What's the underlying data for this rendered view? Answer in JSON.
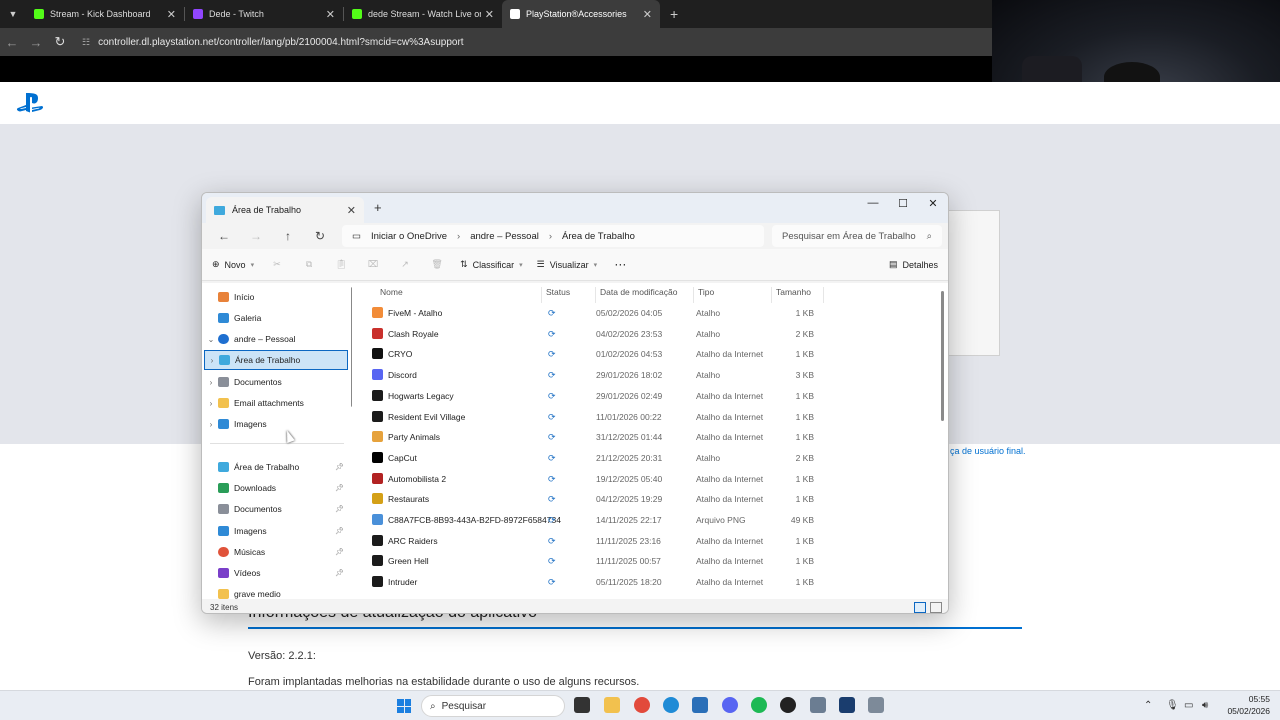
{
  "browser": {
    "tabs": [
      {
        "title": "Stream - Kick Dashboard",
        "favicon_color": "#53fc18"
      },
      {
        "title": "Dede - Twitch",
        "favicon_color": "#9146ff"
      },
      {
        "title": "dede Stream - Watch Live on K",
        "favicon_color": "#53fc18"
      },
      {
        "title": "PlayStation®Accessories",
        "favicon_color": "#ffffff"
      }
    ],
    "url": "controller.dl.playstation.net/controller/lang/pb/2100004.html?smcid=cw%3Asupport"
  },
  "page": {
    "link_text": "ça de usuário final.",
    "section_title": "Informações de atualização do aplicativo",
    "version": "Versão: 2.2.1:",
    "description": "Foram implantadas melhorias na estabilidade durante o uso de alguns recursos."
  },
  "explorer": {
    "tab_title": "Área de Trabalho",
    "breadcrumb": [
      "Iniciar o OneDrive",
      "andre – Pessoal",
      "Área de Trabalho"
    ],
    "search_placeholder": "Pesquisar em Área de Trabalho",
    "toolbar": {
      "new": "Novo",
      "sort": "Classificar",
      "view": "Visualizar",
      "details": "Detalhes"
    },
    "nav": [
      {
        "label": "Início",
        "color": "#e8823a"
      },
      {
        "label": "Galeria",
        "color": "#2f8ad6"
      },
      {
        "label": "andre – Pessoal",
        "color": "#1e6fd0"
      },
      {
        "label": "Área de Trabalho",
        "color": "#3fa9dd"
      },
      {
        "label": "Documentos",
        "color": "#8a8f99"
      },
      {
        "label": "Email attachments",
        "color": "#f2c14e"
      },
      {
        "label": "Imagens",
        "color": "#2f8ad6"
      },
      {
        "label": "Área de Trabalho",
        "color": "#3fa9dd"
      },
      {
        "label": "Downloads",
        "color": "#2a9d58"
      },
      {
        "label": "Documentos",
        "color": "#8a8f99"
      },
      {
        "label": "Imagens",
        "color": "#2f8ad6"
      },
      {
        "label": "Músicas",
        "color": "#e0533a"
      },
      {
        "label": "Vídeos",
        "color": "#7a3fc9"
      },
      {
        "label": "grave medio",
        "color": "#f2c14e"
      }
    ],
    "columns": [
      "Nome",
      "Status",
      "Data de modificação",
      "Tipo",
      "Tamanho"
    ],
    "files": [
      {
        "name": "FiveM - Atalho",
        "date": "05/02/2026 04:05",
        "type": "Atalho",
        "size": "1 KB",
        "color": "#f28c38"
      },
      {
        "name": "Clash Royale",
        "date": "04/02/2026 23:53",
        "type": "Atalho",
        "size": "2 KB",
        "color": "#c9302c"
      },
      {
        "name": "CRYO",
        "date": "01/02/2026 04:53",
        "type": "Atalho da Internet",
        "size": "1 KB",
        "color": "#111111"
      },
      {
        "name": "Discord",
        "date": "29/01/2026 18:02",
        "type": "Atalho",
        "size": "3 KB",
        "color": "#5865f2"
      },
      {
        "name": "Hogwarts Legacy",
        "date": "29/01/2026 02:49",
        "type": "Atalho da Internet",
        "size": "1 KB",
        "color": "#1b1b1b"
      },
      {
        "name": "Resident Evil Village",
        "date": "11/01/2026 00:22",
        "type": "Atalho da Internet",
        "size": "1 KB",
        "color": "#1b1b1b"
      },
      {
        "name": "Party Animals",
        "date": "31/12/2025 01:44",
        "type": "Atalho da Internet",
        "size": "1 KB",
        "color": "#e6a23c"
      },
      {
        "name": "CapCut",
        "date": "21/12/2025 20:31",
        "type": "Atalho",
        "size": "2 KB",
        "color": "#000000"
      },
      {
        "name": "Automobilista 2",
        "date": "19/12/2025 05:40",
        "type": "Atalho da Internet",
        "size": "1 KB",
        "color": "#b22222"
      },
      {
        "name": "Restaurats",
        "date": "04/12/2025 19:29",
        "type": "Atalho da Internet",
        "size": "1 KB",
        "color": "#d4a017"
      },
      {
        "name": "C88A7FCB-8B93-443A-B2FD-8972F6584734",
        "date": "14/11/2025 22:17",
        "type": "Arquivo PNG",
        "size": "49 KB",
        "color": "#4a90d9"
      },
      {
        "name": "ARC Raiders",
        "date": "11/11/2025 23:16",
        "type": "Atalho da Internet",
        "size": "1 KB",
        "color": "#1b1b1b"
      },
      {
        "name": "Green Hell",
        "date": "11/11/2025 00:57",
        "type": "Atalho da Internet",
        "size": "1 KB",
        "color": "#1b1b1b"
      },
      {
        "name": "Intruder",
        "date": "05/11/2025 18:20",
        "type": "Atalho da Internet",
        "size": "1 KB",
        "color": "#1b1b1b"
      }
    ],
    "status": "32 itens"
  },
  "taskbar": {
    "search": "Pesquisar",
    "time": "05:55",
    "date": "05/02/2026"
  }
}
